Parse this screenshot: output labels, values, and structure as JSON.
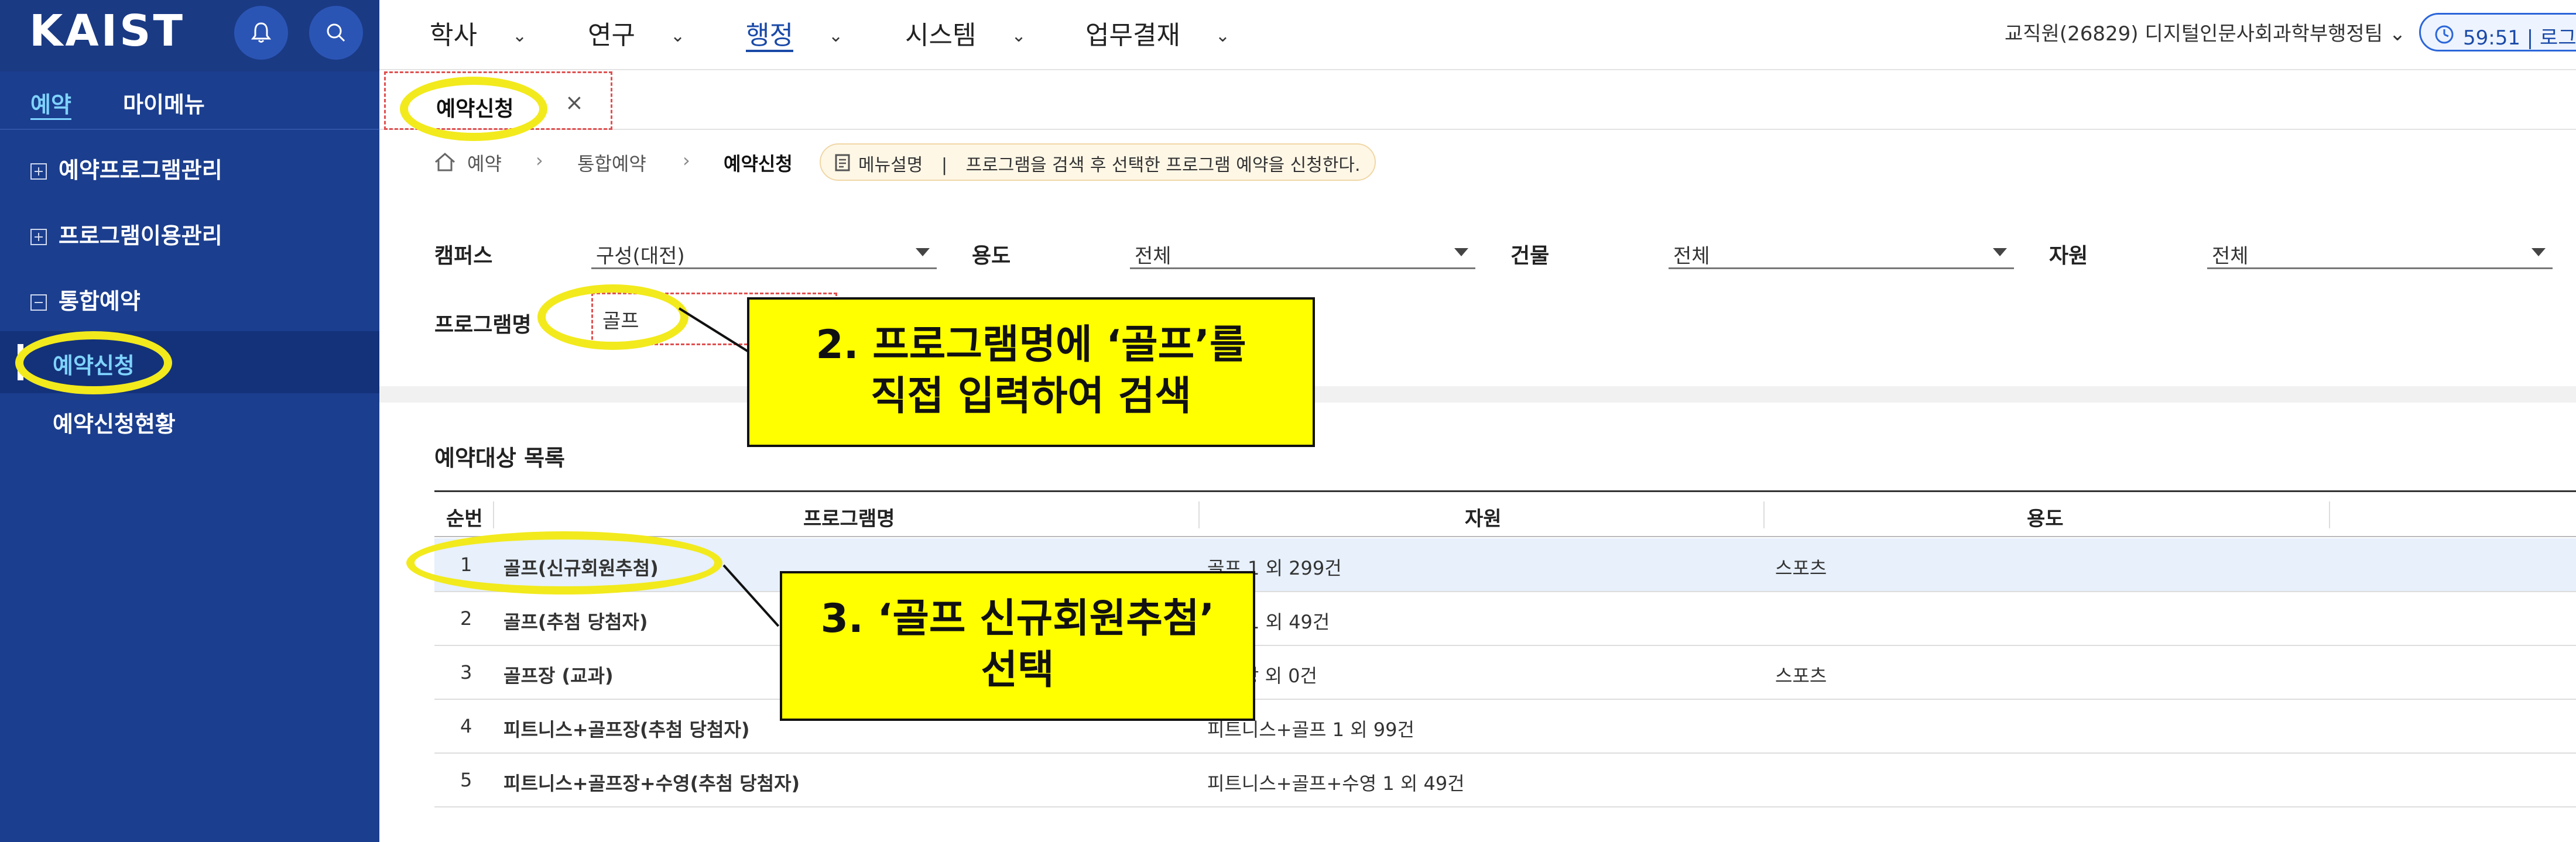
{
  "sidebar": {
    "logo": "KAIST",
    "tabs": [
      "예약",
      "마이메뉴"
    ],
    "menus": [
      "예약프로그램관리",
      "프로그램이용관리",
      "통합예약"
    ],
    "submenus": [
      "예약신청",
      "예약신청현황"
    ]
  },
  "topnav": {
    "items": [
      "학사",
      "연구",
      "행정",
      "시스템",
      "업무결재"
    ],
    "user": "교직원(26829) 디지털인문사회과학부행정팀",
    "timer": "59:51 | 로그"
  },
  "tabstrip": {
    "active_tab": "예약신청",
    "close": "×"
  },
  "breadcrumb": {
    "items": [
      "예약",
      "통합예약",
      "예약신청"
    ],
    "separator": "›",
    "desc_label": "메뉴설명",
    "desc_text": "프로그램을 검색 후 선택한 프로그램 예약을 신청한다."
  },
  "search": {
    "campus_label": "캠퍼스",
    "campus_value": "구성(대전)",
    "usage_label": "용도",
    "usage_value": "전체",
    "building_label": "건물",
    "building_value": "전체",
    "resource_label": "자원",
    "resource_value": "전체",
    "program_label": "프로그램명",
    "program_value": "골프"
  },
  "list": {
    "title": "예약대상 목록",
    "columns": [
      "순번",
      "프로그램명",
      "자원",
      "용도"
    ],
    "rows": [
      {
        "no": "1",
        "name": "골프(신규회원추첨)",
        "resource": "골프 1 외 299건",
        "usage": "스포츠"
      },
      {
        "no": "2",
        "name": "골프(추첨 당첨자)",
        "resource": "골프 1 외 49건",
        "usage": ""
      },
      {
        "no": "3",
        "name": "골프장 (교과)",
        "resource": "골프장 외 0건",
        "usage": "스포츠"
      },
      {
        "no": "4",
        "name": "피트니스+골프장(추첨 당첨자)",
        "resource": "피트니스+골프 1 외 99건",
        "usage": ""
      },
      {
        "no": "5",
        "name": "피트니스+골프장+수영(추첨 당첨자)",
        "resource": "피트니스+골프+수영 1 외 49건",
        "usage": ""
      }
    ]
  },
  "annotations": {
    "callout_2_line1": "2. 프로그램명에 ‘골프’를",
    "callout_2_line2": "직접 입력하여 검색",
    "callout_3_line1": "3. ‘골프 신규회원추첨’",
    "callout_3_line2": "선택",
    "highlight_color": "#f2ea1c"
  }
}
